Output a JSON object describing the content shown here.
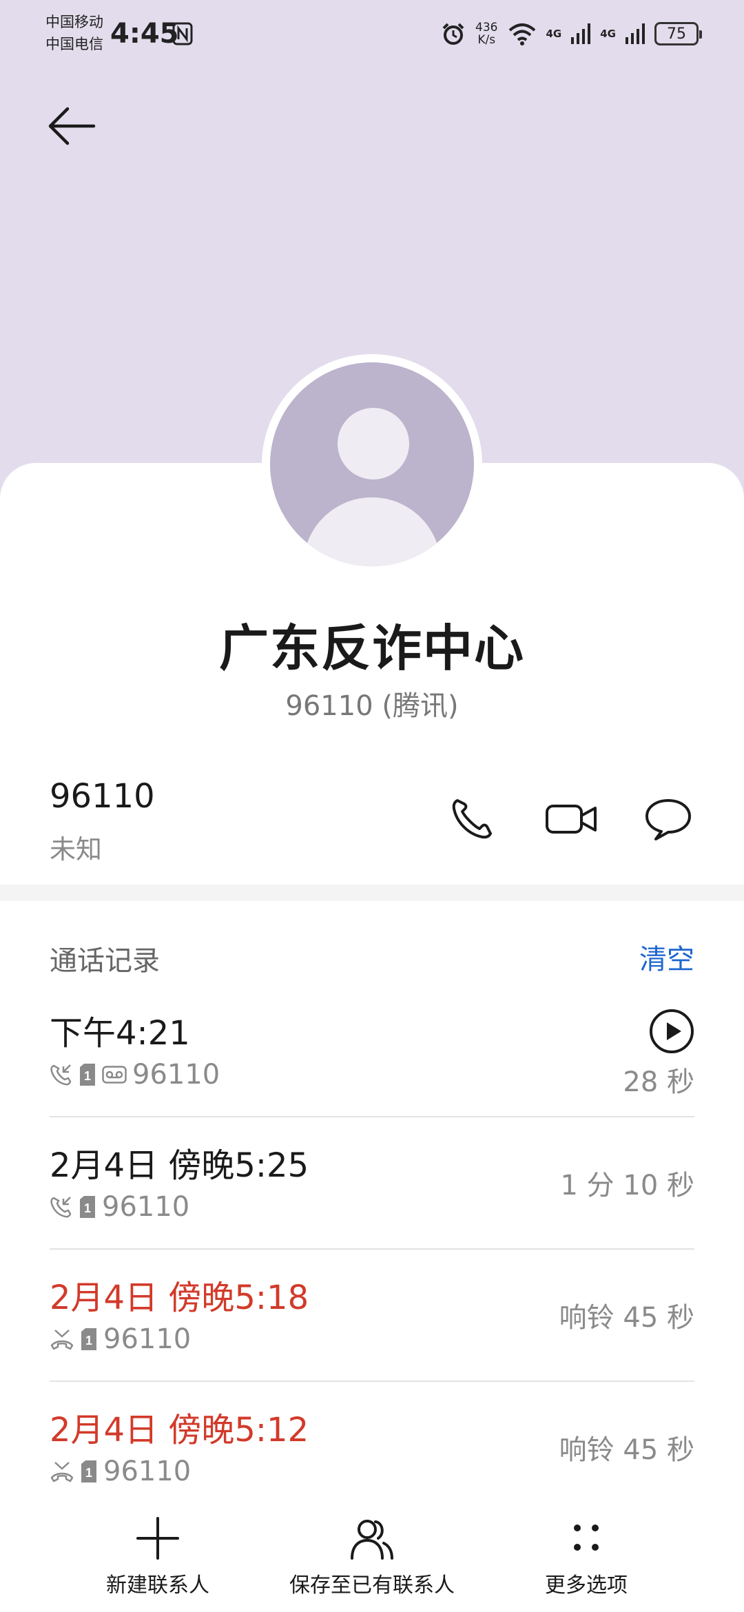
{
  "status_bar": {
    "carrier1": "中国移动",
    "carrier2": "中国电信",
    "time": "4:45",
    "speed_value": "436",
    "speed_unit": "K/s",
    "net1": "4G",
    "net2": "4G",
    "battery": "75"
  },
  "contact": {
    "name": "广东反诈中心",
    "subtitle": "96110 (腾讯)",
    "number": "96110",
    "location": "未知"
  },
  "call_log": {
    "title": "通话记录",
    "clear_label": "清空",
    "records": [
      {
        "time": "下午4:21",
        "number": "96110",
        "duration": "28 秒",
        "missed": false
      },
      {
        "time": "2月4日 傍晚5:25",
        "number": "96110",
        "duration": "1 分 10 秒",
        "missed": false
      },
      {
        "time": "2月4日 傍晚5:18",
        "number": "96110",
        "duration": "响铃 45 秒",
        "missed": true
      },
      {
        "time": "2月4日 傍晚5:12",
        "number": "96110",
        "duration": "响铃 45 秒",
        "missed": true
      }
    ]
  },
  "bottom_bar": {
    "new_contact": "新建联系人",
    "save_existing": "保存至已有联系人",
    "more": "更多选项"
  },
  "colors": {
    "header_bg": "#e2dcec",
    "avatar_bg": "#bcb3cc",
    "accent_blue": "#1f66d0",
    "missed_red": "#d23a2a"
  }
}
